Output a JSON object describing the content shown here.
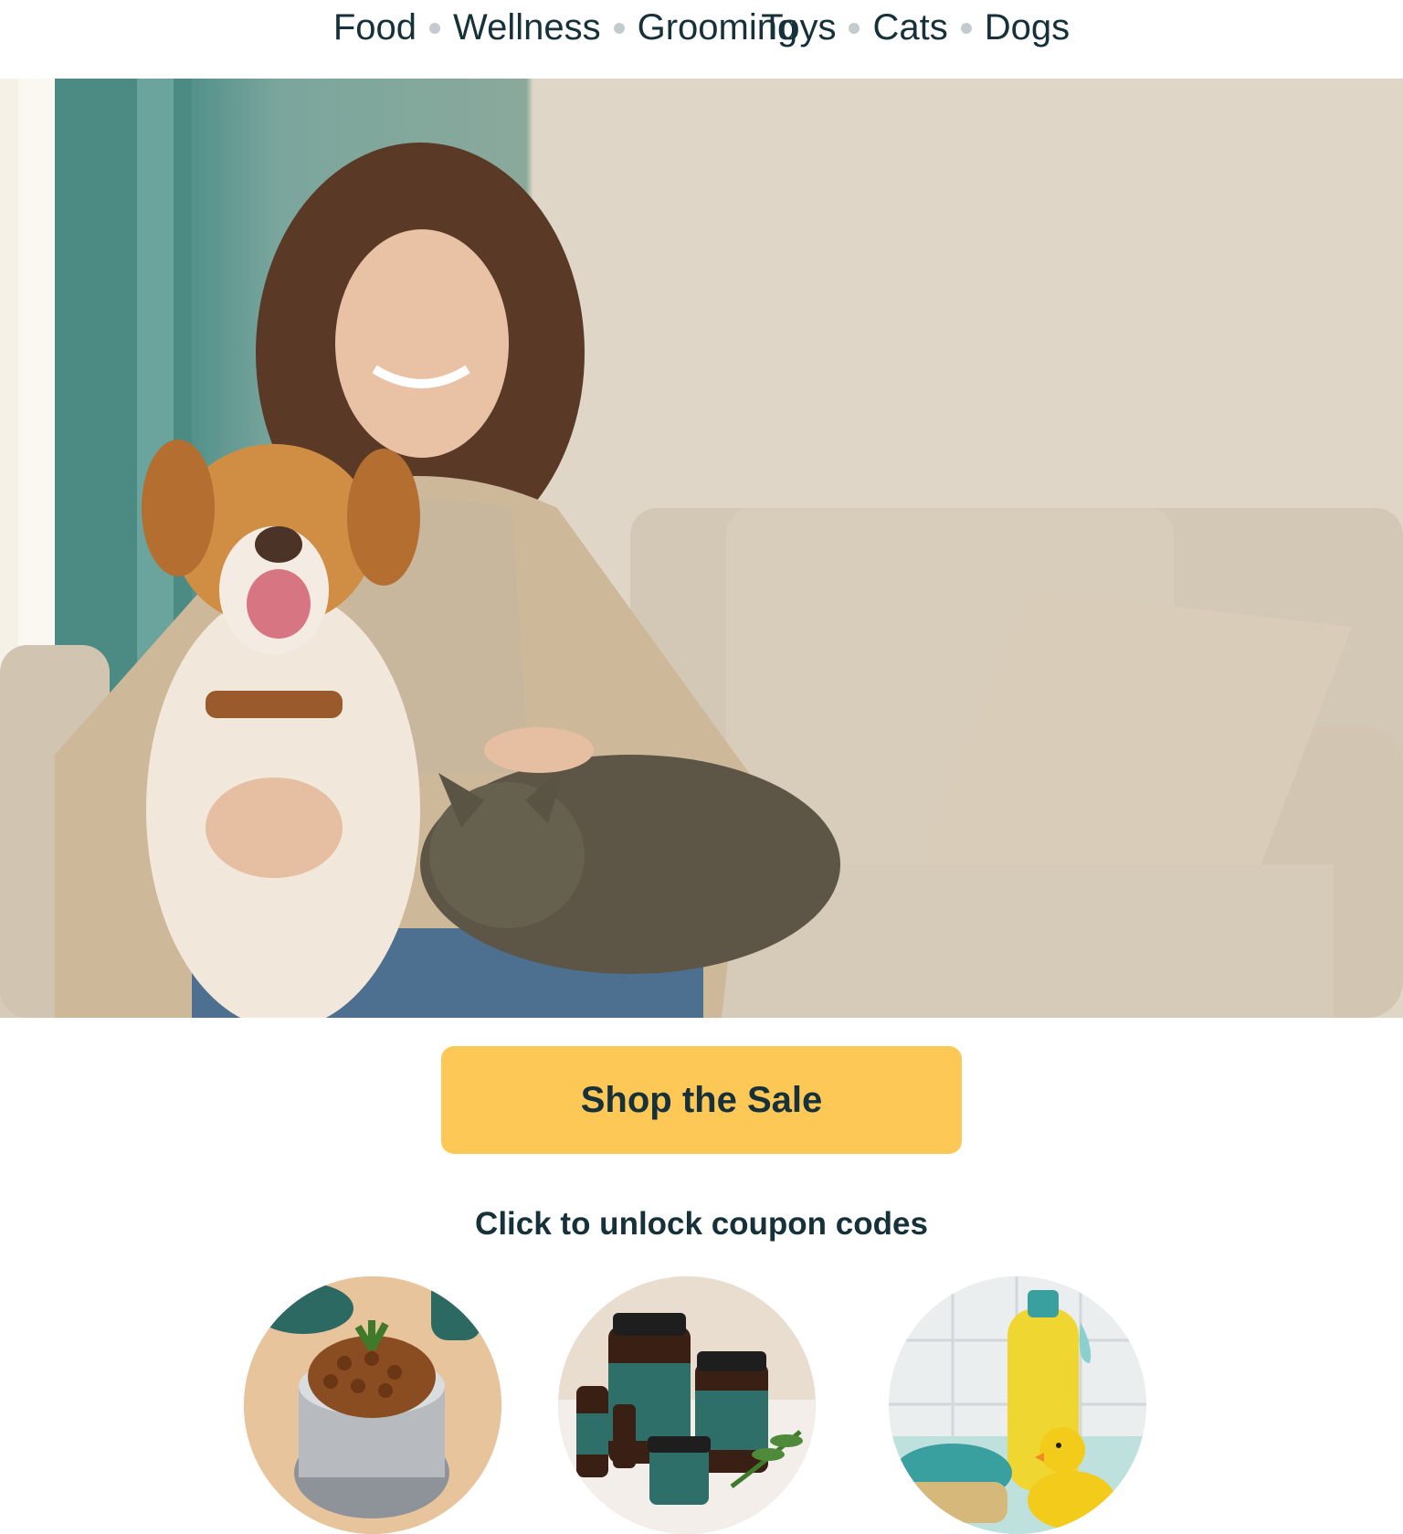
{
  "nav": {
    "items": [
      {
        "label": "Food"
      },
      {
        "label": "Wellness"
      },
      {
        "label": "Grooming"
      },
      {
        "label": "Toys"
      },
      {
        "label": "Cats"
      },
      {
        "label": "Dogs"
      }
    ]
  },
  "hero": {
    "image": "woman-with-dog-and-cat-on-sofa"
  },
  "cta": {
    "label": "Shop the Sale",
    "color": "#fdc856"
  },
  "coupons": {
    "heading": "Click to unlock coupon codes",
    "tiles": [
      {
        "icon": "food-bowl-image"
      },
      {
        "icon": "wellness-supplements-image"
      },
      {
        "icon": "grooming-products-image"
      }
    ]
  },
  "colors": {
    "text": "#16313a",
    "separator": "#c4cbcf",
    "accent": "#fdc856",
    "teal": "#2f6f6a"
  }
}
